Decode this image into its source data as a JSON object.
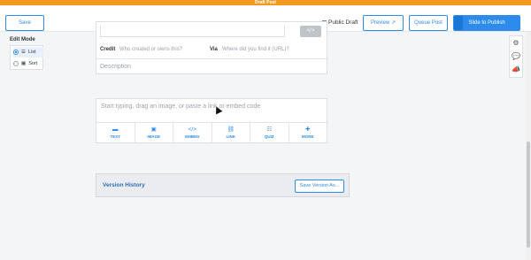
{
  "topbar": {
    "title": "Draft Post",
    "color": "#f39a1e"
  },
  "header": {
    "save_label": "Save",
    "public_draft_label": "Public Draft",
    "preview_label": "Preview",
    "queue_label": "Queue Post",
    "publish_label": "Slide to Publish",
    "accent": "#2d8ceb"
  },
  "edit_mode": {
    "title": "Edit Mode",
    "options": [
      {
        "label": "List",
        "icon": "list-icon",
        "selected": true
      },
      {
        "label": "Sort",
        "icon": "grid-icon",
        "selected": false
      }
    ]
  },
  "source_card": {
    "credit_label": "Credit",
    "credit_placeholder": "Who created or owns this?",
    "via_label": "Via",
    "via_placeholder": "Where did you find it (URL)?",
    "description_placeholder": "Description",
    "go_icon": "link-icon"
  },
  "content_card": {
    "placeholder": "Start typing, drag an image, or paste a link or embed code",
    "tools": [
      {
        "label": "TEXT",
        "icon": "text-icon"
      },
      {
        "label": "IMAGE",
        "icon": "image-icon"
      },
      {
        "label": "EMBED",
        "icon": "code-icon"
      },
      {
        "label": "LINK",
        "icon": "link-icon"
      },
      {
        "label": "QUIZ",
        "icon": "quiz-icon"
      },
      {
        "label": "MORE",
        "icon": "plus-icon"
      }
    ]
  },
  "version_history": {
    "title": "Version History",
    "button_label": "Save Version As..."
  },
  "right_sidebar": {
    "icons": [
      "gear-icon",
      "comment-icon",
      "megaphone-icon"
    ]
  }
}
